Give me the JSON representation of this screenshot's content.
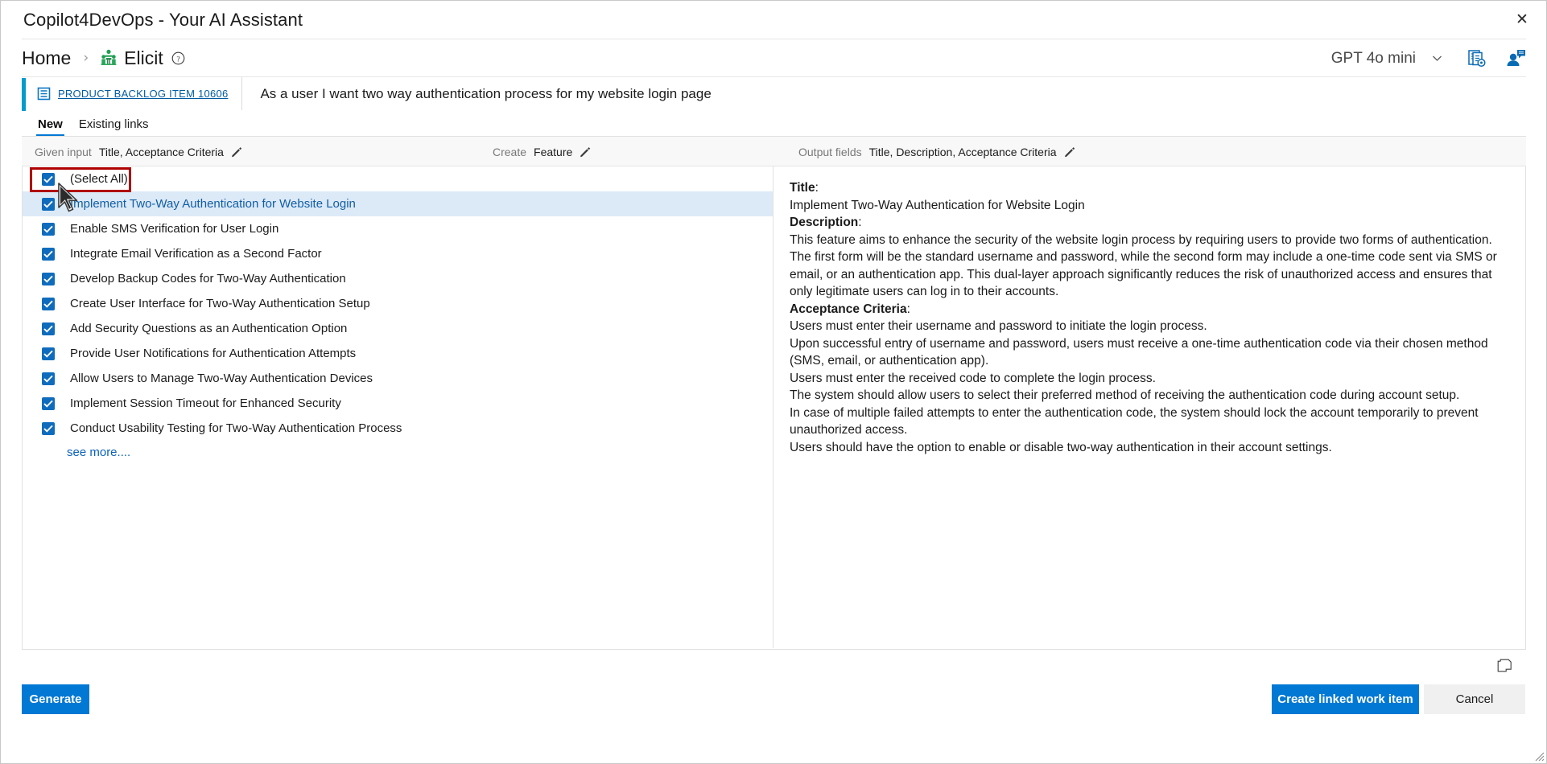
{
  "window": {
    "title": "Copilot4DevOps - Your AI Assistant",
    "close_label": "✕"
  },
  "breadcrumb": {
    "home": "Home",
    "separator": "›",
    "current": "Elicit",
    "home_icon": "home-text",
    "elicit_icon": "meeting-people-icon",
    "help_icon": "question-circle-icon"
  },
  "header_right": {
    "model": "GPT 4o mini",
    "chevron_icon": "chevron-down-icon",
    "settings_icon": "document-settings-icon",
    "user_icon": "user-feedback-icon"
  },
  "work_item": {
    "type_icon": "backlog-item-icon",
    "id_label": "PRODUCT BACKLOG ITEM 10606",
    "title": "As a user I want two way authentication process for my website login page",
    "accent_color": "#009ccc"
  },
  "tabs": [
    {
      "label": "New",
      "active": true
    },
    {
      "label": "Existing links",
      "active": false
    }
  ],
  "options_bar": {
    "given_input": {
      "label": "Given input",
      "value": "Title, Acceptance Criteria",
      "edit_icon": "pencil-icon"
    },
    "create": {
      "label": "Create",
      "value": "Feature",
      "edit_icon": "pencil-icon"
    },
    "output_fields": {
      "label": "Output fields",
      "value": "Title, Description, Acceptance Criteria",
      "edit_icon": "pencil-icon"
    }
  },
  "suggestion_list": {
    "select_all": {
      "label": "(Select All)",
      "checked": true,
      "highlighted": true
    },
    "items": [
      {
        "label": "Implement Two-Way Authentication for Website Login",
        "checked": true,
        "selected": true
      },
      {
        "label": "Enable SMS Verification for User Login",
        "checked": true,
        "selected": false
      },
      {
        "label": "Integrate Email Verification as a Second Factor",
        "checked": true,
        "selected": false
      },
      {
        "label": "Develop Backup Codes for Two-Way Authentication",
        "checked": true,
        "selected": false
      },
      {
        "label": "Create User Interface for Two-Way Authentication Setup",
        "checked": true,
        "selected": false
      },
      {
        "label": "Add Security Questions as an Authentication Option",
        "checked": true,
        "selected": false
      },
      {
        "label": "Provide User Notifications for Authentication Attempts",
        "checked": true,
        "selected": false
      },
      {
        "label": "Allow Users to Manage Two-Way Authentication Devices",
        "checked": true,
        "selected": false
      },
      {
        "label": "Implement Session Timeout for Enhanced Security",
        "checked": true,
        "selected": false
      },
      {
        "label": "Conduct Usability Testing for Two-Way Authentication Process",
        "checked": true,
        "selected": false
      }
    ],
    "see_more": "see more...."
  },
  "detail_panel": {
    "title_heading": "Title",
    "title_value": "Implement Two-Way Authentication for Website Login",
    "description_heading": "Description",
    "description_value": "This feature aims to enhance the security of the website login process by requiring users to provide two forms of authentication. The first form will be the standard username and password, while the second form may include a one-time code sent via SMS or email, or an authentication app. This dual-layer approach significantly reduces the risk of unauthorized access and ensures that only legitimate users can log in to their accounts.",
    "acceptance_heading": "Acceptance Criteria",
    "acceptance_lines": [
      "Users must enter their username and password to initiate the login process.",
      "Upon successful entry of username and password, users must receive a one-time authentication code via their chosen method (SMS, email, or authentication app).",
      "Users must enter the received code to complete the login process.",
      "The system should allow users to select their preferred method of receiving the authentication code during account setup.",
      "In case of multiple failed attempts to enter the authentication code, the system should lock the account temporarily to prevent unauthorized access.",
      "Users should have the option to enable or disable two-way authentication in their account settings."
    ],
    "colon": ":"
  },
  "footer": {
    "generate_label": "Generate",
    "create_linked_label": "Create linked work item",
    "cancel_label": "Cancel",
    "copy_icon": "copy-icon",
    "resize_grip_icon": "resize-grip-icon"
  },
  "colors": {
    "accent_blue": "#0078d4",
    "checkbox_blue": "#0f6cbd",
    "link_blue": "#005ba1",
    "selected_row": "#dce9f7",
    "highlight_red": "#b00000",
    "work_item_accent": "#009ccc"
  }
}
